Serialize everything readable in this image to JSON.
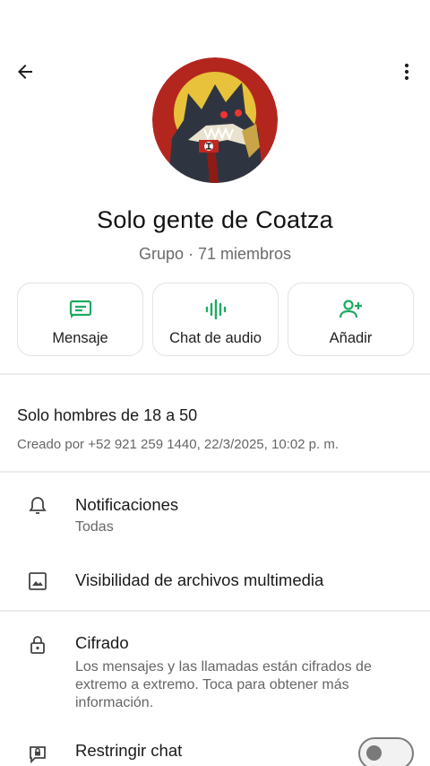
{
  "header": {
    "back_icon": "arrow-left-icon",
    "more_icon": "more-vert-icon"
  },
  "group": {
    "name": "Solo gente de Coatza",
    "subtitle": "Grupo · 71 miembros"
  },
  "actions": [
    {
      "label": "Mensaje",
      "icon": "message-icon"
    },
    {
      "label": "Chat de audio",
      "icon": "audio-wave-icon"
    },
    {
      "label": "Añadir",
      "icon": "add-person-icon"
    }
  ],
  "description": {
    "text": "Solo hombres de 18 a 50",
    "created": "Creado por +52 921 259 1440, 22/3/2025, 10:02 p. m."
  },
  "settings": {
    "notifications": {
      "title": "Notificaciones",
      "value": "Todas"
    },
    "media": {
      "title": "Visibilidad de archivos multimedia"
    },
    "encryption": {
      "title": "Cifrado",
      "description": "Los mensajes y las llamadas están cifrados de extremo a extremo. Toca para obtener más información."
    },
    "restrict": {
      "title": "Restringir chat",
      "enabled": false
    }
  },
  "colors": {
    "accent": "#1DAA61",
    "text": "#1f1f1f",
    "secondary": "#666666"
  }
}
